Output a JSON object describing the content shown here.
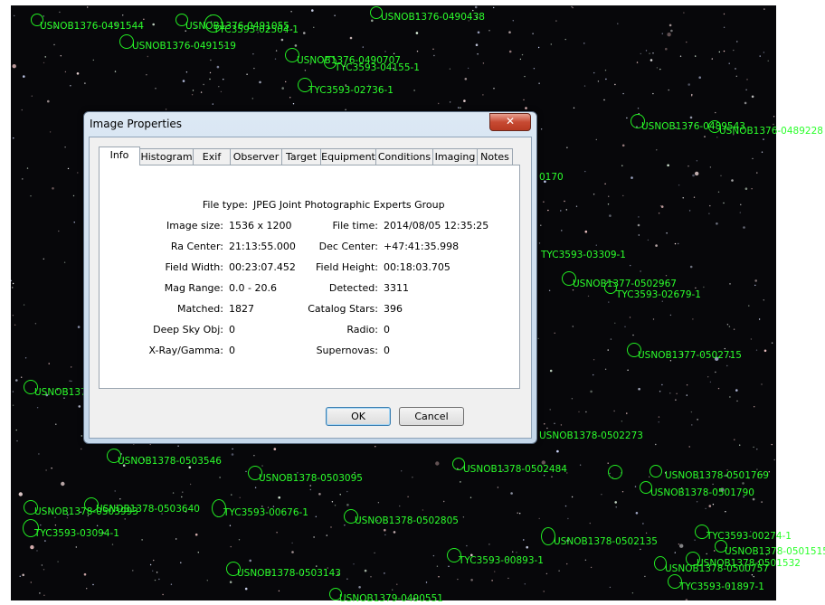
{
  "dialog": {
    "title": "Image Properties",
    "close_label": "✕",
    "tabs": [
      "Info",
      "Histogram",
      "Exif",
      "Observer",
      "Target",
      "Equipment",
      "Conditions",
      "Imaging",
      "Notes"
    ],
    "active_tab": "Info",
    "file_type_label": "File type:",
    "file_type_value": "JPEG Joint Photographic Experts Group",
    "rows": [
      {
        "k1": "Image size:",
        "v1": "1536 x 1200",
        "k2": "File time:",
        "v2": "2014/08/05 12:35:25"
      },
      {
        "k1": "Ra Center:",
        "v1": "21:13:55.000",
        "k2": "Dec Center:",
        "v2": "+47:41:35.998"
      },
      {
        "k1": "Field Width:",
        "v1": "00:23:07.452",
        "k2": "Field Height:",
        "v2": "00:18:03.705"
      },
      {
        "k1": "Mag Range:",
        "v1": "0.0 - 20.6",
        "k2": "Detected:",
        "v2": "3311"
      },
      {
        "k1": "Matched:",
        "v1": "1827",
        "k2": "Catalog Stars:",
        "v2": "396"
      },
      {
        "k1": "Deep Sky Obj:",
        "v1": "0",
        "k2": "Radio:",
        "v2": "0"
      },
      {
        "k1": "X-Ray/Gamma:",
        "v1": "0",
        "k2": "Supernovas:",
        "v2": "0"
      }
    ],
    "ok_label": "OK",
    "cancel_label": "Cancel"
  },
  "star_labels": [
    "USNOB1376-0491544",
    "USNOB1376-0491055",
    "TYC3593-02504-1",
    "USNOB1376-0490438",
    "USNOB1376-0491519",
    "USNOB1376-0490707",
    "TYC3593-04155-1",
    "TYC3593-02736-1",
    "USNOB1376-0489543",
    "USNOB1376-0489228",
    "USNOB1377-0502967",
    "TYC3593-02679-1",
    "USNOB1377-0502715",
    "USNOB1378-0503546",
    "USNOB1378-0503095",
    "USNOB1378-0502484",
    "USNOB1378-0502273",
    "USNOB1378-0501769",
    "USNOB1378-0501790",
    "USNOB1378-0503640",
    "USNOB1378-0503993",
    "TYC3593-00676-1",
    "USNOB1378-0502805",
    "TYC3593-03094-1",
    "USNOB1378-0502135",
    "TYC3593-00274-1",
    "USNOB1378-0501515",
    "TYC3593-00893-1",
    "USNOB1378-0501532",
    "USNOB1378-0503143",
    "TYC3593-01897-1",
    "USNOB1379-0490551",
    "USNOB1378-0500757",
    "USNOB137",
    "TYC3593-03309-1",
    "0170"
  ]
}
